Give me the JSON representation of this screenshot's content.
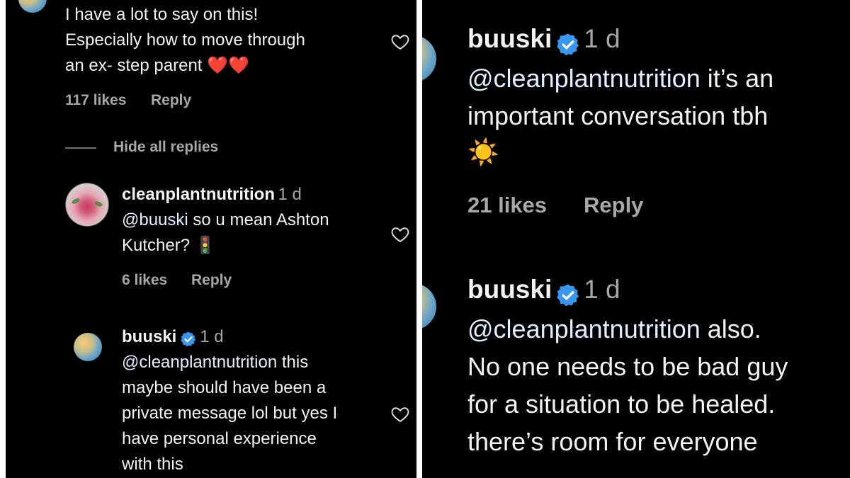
{
  "left": {
    "top_comment": {
      "lines": [
        "I have a lot to say on this!",
        "Especially how to move through",
        "an ex- step parent"
      ],
      "emoji": "❤️❤️",
      "likes": "117 likes",
      "reply": "Reply"
    },
    "hide_replies": "Hide all replies",
    "reply1": {
      "username": "cleanplantnutrition",
      "time": "1 d",
      "mention": "@buuski",
      "line1_rest": " so u mean Ashton",
      "line2": "Kutcher?",
      "emoji": "🚦",
      "likes": "6 likes",
      "reply": "Reply"
    },
    "reply2": {
      "username": "buuski",
      "time": "1 d",
      "mention": "@cleanplantnutrition",
      "line1_rest": " this",
      "lines": [
        "maybe should have been a",
        "private message lol but yes I",
        "have personal experience",
        "with this"
      ]
    }
  },
  "right": {
    "comment1": {
      "username": "buuski",
      "time": "1 d",
      "mention": "@cleanplantnutrition",
      "line1_rest": " it’s an",
      "line2": "important conversation tbh",
      "emoji": "☀️",
      "likes": "21 likes",
      "reply": "Reply"
    },
    "comment2": {
      "username": "buuski",
      "time": "1 d",
      "mention": "@cleanplantnutrition",
      "line1_rest": " also.",
      "lines": [
        "No one needs to be bad guy",
        "for a situation to be healed.",
        "there’s room for everyone"
      ]
    }
  },
  "icons": {
    "heart": "heart-outline-icon",
    "verified": "verified-badge-icon"
  },
  "colors": {
    "background": "#000000",
    "text": "#f3f3f3",
    "meta": "#a8a8a8",
    "mention": "#e0f1ff",
    "verified": "#3897f0"
  }
}
